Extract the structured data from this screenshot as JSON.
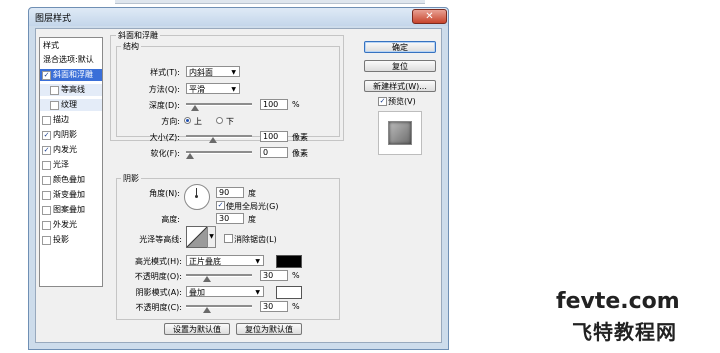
{
  "window": {
    "title": "图层样式",
    "close_glyph": "✕"
  },
  "style_list": {
    "header": "样式",
    "items": [
      {
        "label": "混合选项:默认",
        "checkbox": null,
        "checked": false,
        "selected": false,
        "sub": false
      },
      {
        "label": "斜面和浮雕",
        "checkbox": true,
        "checked": true,
        "selected": true,
        "sub": false
      },
      {
        "label": "等高线",
        "checkbox": true,
        "checked": false,
        "selected": false,
        "sub": true
      },
      {
        "label": "纹理",
        "checkbox": true,
        "checked": false,
        "selected": false,
        "sub": true
      },
      {
        "label": "描边",
        "checkbox": true,
        "checked": false,
        "selected": false,
        "sub": false
      },
      {
        "label": "内阴影",
        "checkbox": true,
        "checked": true,
        "selected": false,
        "sub": false
      },
      {
        "label": "内发光",
        "checkbox": true,
        "checked": true,
        "selected": false,
        "sub": false
      },
      {
        "label": "光泽",
        "checkbox": true,
        "checked": false,
        "selected": false,
        "sub": false
      },
      {
        "label": "颜色叠加",
        "checkbox": true,
        "checked": false,
        "selected": false,
        "sub": false
      },
      {
        "label": "渐变叠加",
        "checkbox": true,
        "checked": false,
        "selected": false,
        "sub": false
      },
      {
        "label": "图案叠加",
        "checkbox": true,
        "checked": false,
        "selected": false,
        "sub": false
      },
      {
        "label": "外发光",
        "checkbox": true,
        "checked": false,
        "selected": false,
        "sub": false
      },
      {
        "label": "投影",
        "checkbox": true,
        "checked": false,
        "selected": false,
        "sub": false
      }
    ]
  },
  "bevel": {
    "group_title": "斜面和浮雕",
    "structure_title": "结构",
    "style_label": "样式(T):",
    "style_value": "内斜面",
    "technique_label": "方法(Q):",
    "technique_value": "平滑",
    "depth_label": "深度(D):",
    "depth_value": "100",
    "depth_unit": "%",
    "depth_level": 0.08,
    "direction_label": "方向:",
    "dir_up": "上",
    "dir_down": "下",
    "size_label": "大小(Z):",
    "size_value": "100",
    "size_unit": "像素",
    "size_level": 0.4,
    "soften_label": "软化(F):",
    "soften_value": "0",
    "soften_unit": "像素",
    "soften_level": 0.0
  },
  "shading": {
    "title": "阴影",
    "angle_label": "角度(N):",
    "angle_value": "90",
    "angle_unit": "度",
    "global_light_label": "使用全局光(G)",
    "global_light_checked": true,
    "altitude_label": "高度:",
    "altitude_value": "30",
    "altitude_unit": "度",
    "gloss_label": "光泽等高线:",
    "antialias_label": "消除锯齿(L)",
    "antialias_checked": false,
    "highlight_label": "高光模式(H):",
    "highlight_mode": "正片叠底",
    "highlight_color": "#000000",
    "hl_opacity_label": "不透明度(O):",
    "hl_opacity_value": "30",
    "hl_opacity_unit": "%",
    "hl_opacity_level": 0.3,
    "shadow_label": "阴影模式(A):",
    "shadow_mode": "叠加",
    "shadow_color": "#ffffff",
    "sh_opacity_label": "不透明度(C):",
    "sh_opacity_value": "30",
    "sh_opacity_unit": "%",
    "sh_opacity_level": 0.3
  },
  "bottom_buttons": {
    "make_default": "设置为默认值",
    "reset_default": "复位为默认值"
  },
  "right_panel": {
    "ok": "确定",
    "reset": "复位",
    "new_style": "新建样式(W)...",
    "preview_label": "预览(V)",
    "preview_checked": true
  },
  "watermark": {
    "line1": "fevte.com",
    "line2": "飞特教程网"
  },
  "colors": {
    "accent": "#3a6fd8",
    "title_bar": "#cddceb"
  }
}
